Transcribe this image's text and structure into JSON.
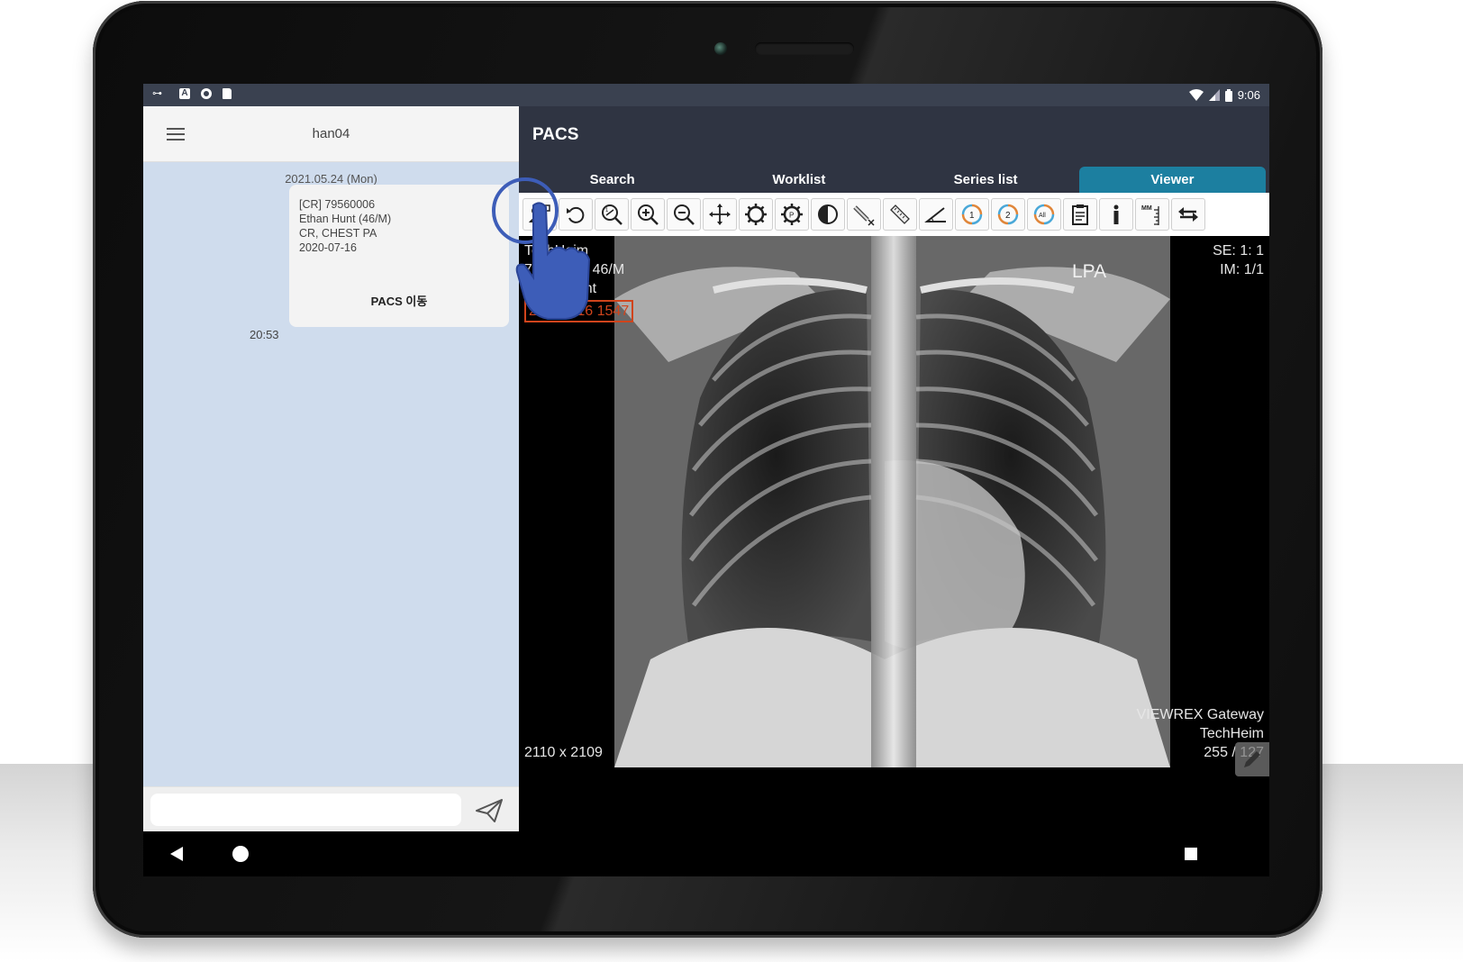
{
  "status_bar": {
    "left_icons": [
      "key-icon",
      "a-icon",
      "circle-icon",
      "sd-card-icon"
    ],
    "time": "9:06",
    "right_icons": [
      "wifi-icon",
      "signal-icon",
      "battery-icon"
    ]
  },
  "chat": {
    "title": "han04",
    "date": "2021.05.24 (Mon)",
    "message": {
      "lines": [
        "[CR] 79560006",
        "Ethan Hunt (46/M)",
        "CR, CHEST PA",
        "2020-07-16"
      ],
      "action_label": "PACS 이동",
      "time": "20:53"
    },
    "input_value": "",
    "send_icon": "send-icon"
  },
  "pacs": {
    "title": "PACS",
    "tabs": [
      {
        "label": "Search",
        "active": false
      },
      {
        "label": "Worklist",
        "active": false
      },
      {
        "label": "Series list",
        "active": false
      },
      {
        "label": "Viewer",
        "active": true
      }
    ],
    "toolbar": [
      "patient-share-icon",
      "rotate-icon",
      "zoom-fit-icon",
      "zoom-in-icon",
      "zoom-out-icon",
      "pan-icon",
      "window-level-icon",
      "preset-icon",
      "invert-icon",
      "eraser-icon",
      "ruler-icon",
      "angle-icon",
      "sync-1-icon",
      "sync-2-icon",
      "sync-all-icon",
      "report-icon",
      "info-icon",
      "mm-scale-icon",
      "swap-icon"
    ],
    "overlay": {
      "top_left": [
        "TechHeim",
        "79560006 46/M",
        "Ethan Hunt"
      ],
      "top_left_highlight": "20200716 1547",
      "top_right": [
        "SE:  1: 1",
        "IM:  1/1"
      ],
      "orientation": "LPA",
      "bottom_left": "2110 x 2109",
      "bottom_right": [
        "VIEWREX Gateway",
        "TechHeim",
        "255 / 127"
      ]
    }
  },
  "colors": {
    "header_bg": "#2f3442",
    "active_tab": "#1c7fa0",
    "chat_bg": "#cfdced",
    "highlight": "#d0441c",
    "touch": "#3d5db8"
  }
}
